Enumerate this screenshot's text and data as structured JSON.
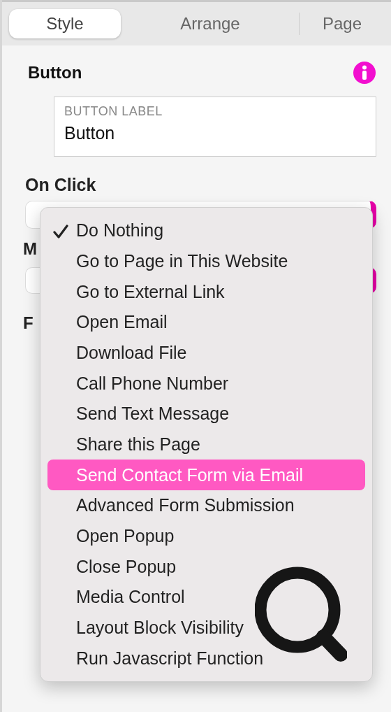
{
  "tabs": [
    {
      "label": "Style",
      "selected": true
    },
    {
      "label": "Arrange",
      "selected": false
    },
    {
      "label": "Page",
      "selected": false
    }
  ],
  "header": {
    "title": "Button"
  },
  "button_label_field": {
    "label": "BUTTON LABEL",
    "value": "Button"
  },
  "on_click": {
    "label": "On Click"
  },
  "hidden_labels": [
    "M",
    "F"
  ],
  "menu": {
    "items": [
      {
        "label": "Do Nothing",
        "checked": true,
        "selected": false
      },
      {
        "label": "Go to Page in This Website",
        "checked": false,
        "selected": false
      },
      {
        "label": "Go to External Link",
        "checked": false,
        "selected": false
      },
      {
        "label": "Open Email",
        "checked": false,
        "selected": false
      },
      {
        "label": "Download File",
        "checked": false,
        "selected": false
      },
      {
        "label": "Call Phone Number",
        "checked": false,
        "selected": false
      },
      {
        "label": "Send Text Message",
        "checked": false,
        "selected": false
      },
      {
        "label": "Share this Page",
        "checked": false,
        "selected": false
      },
      {
        "label": "Send Contact Form via Email",
        "checked": false,
        "selected": true
      },
      {
        "label": "Advanced Form Submission",
        "checked": false,
        "selected": false
      },
      {
        "label": "Open Popup",
        "checked": false,
        "selected": false
      },
      {
        "label": "Close Popup",
        "checked": false,
        "selected": false
      },
      {
        "label": "Media Control",
        "checked": false,
        "selected": false
      },
      {
        "label": "Layout Block Visibility",
        "checked": false,
        "selected": false
      },
      {
        "label": "Run Javascript Function",
        "checked": false,
        "selected": false
      }
    ]
  }
}
